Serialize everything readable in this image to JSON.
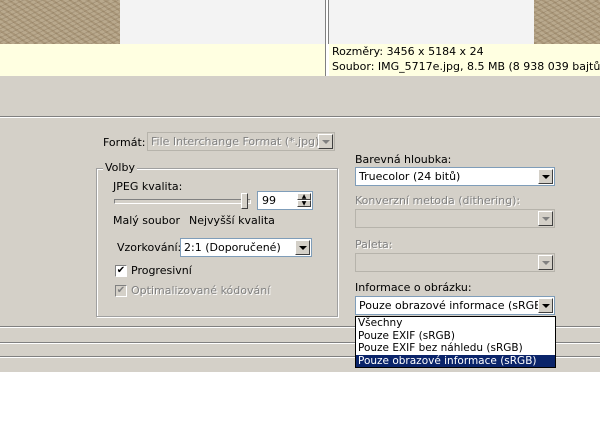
{
  "preview": {
    "info_line1": "Rozměry: 3456 x 5184 x 24",
    "info_line2": "Soubor: IMG_5717e.jpg, 8.5 MB (8 938 039 bajtů)"
  },
  "format": {
    "label": "Formát:",
    "value": "File Interchange Format (*.jpg)"
  },
  "options": {
    "group_title": "Volby",
    "jpeg_quality_label": "JPEG kvalita:",
    "jpeg_quality_value": "99",
    "jpeg_quality_level": 0.99,
    "small_file_label": "Malý soubor",
    "highest_quality_label": "Nejvyšší kvalita",
    "sampling_label": "Vzorkování:",
    "sampling_value": "2:1 (Doporučené)",
    "progressive_label": "Progresivní",
    "progressive_checked": true,
    "optimized_label": "Optimalizované kódování",
    "optimized_checked": true
  },
  "right": {
    "color_depth_label": "Barevná hloubka:",
    "color_depth_value": "Truecolor (24 bitů)",
    "conversion_label": "Konverzní metoda (dithering):",
    "conversion_value": "",
    "palette_label": "Paleta:",
    "palette_value": "",
    "image_info_label": "Informace o obrázku:",
    "image_info_value": "Pouze obrazové informace (sRGB)",
    "image_info_options": [
      "Všechny",
      "Pouze EXIF (sRGB)",
      "Pouze EXIF bez náhledu (sRGB)",
      "Pouze obrazové informace (sRGB)"
    ]
  },
  "icons": {
    "check": "check-icon",
    "arrow": "chevron-down-icon"
  }
}
